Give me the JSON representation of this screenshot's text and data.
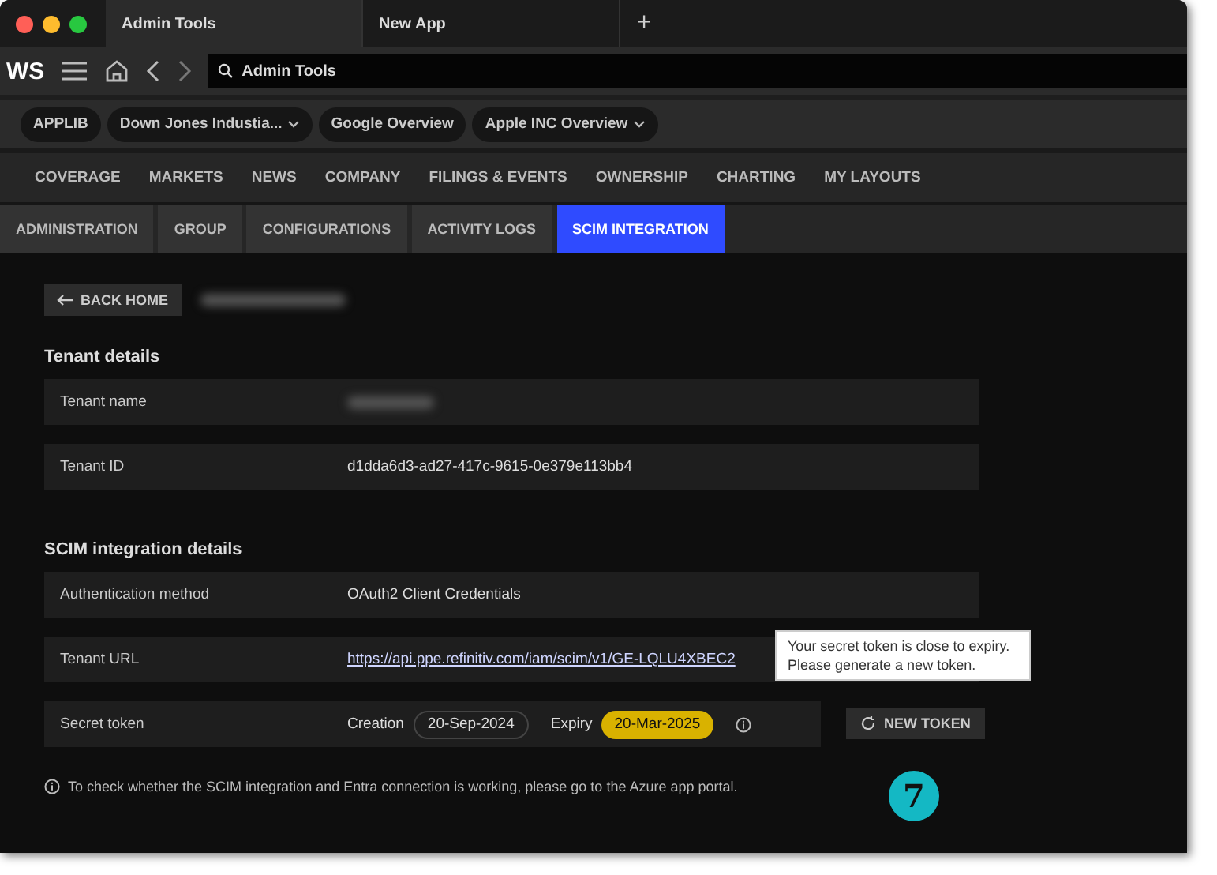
{
  "window_tabs": [
    {
      "label": "Admin Tools",
      "selected": true
    },
    {
      "label": "New App",
      "selected": false
    }
  ],
  "new_tab": "+",
  "toolbar": {
    "logo": "WS",
    "search_value": "Admin Tools"
  },
  "chips": [
    {
      "label": "APPLIB",
      "dropdown": false
    },
    {
      "label": "Down Jones Industia...",
      "dropdown": true
    },
    {
      "label": "Google Overview",
      "dropdown": false
    },
    {
      "label": "Apple INC Overview",
      "dropdown": true
    }
  ],
  "nav": [
    "COVERAGE",
    "MARKETS",
    "NEWS",
    "COMPANY",
    "FILINGS & EVENTS",
    "OWNERSHIP",
    "CHARTING",
    "MY LAYOUTS"
  ],
  "sub_tabs": [
    {
      "label": "ADMINISTRATION",
      "selected": false
    },
    {
      "label": "GROUP",
      "selected": false
    },
    {
      "label": "CONFIGURATIONS",
      "selected": false
    },
    {
      "label": "ACTIVITY LOGS",
      "selected": false
    },
    {
      "label": "SCIM INTEGRATION",
      "selected": true
    }
  ],
  "back_button": "BACK HOME",
  "sections": [
    {
      "title": "Tenant details",
      "rows": [
        {
          "kind": "text",
          "label": "Tenant name",
          "value": "",
          "redacted": true
        },
        {
          "kind": "text",
          "label": "Tenant ID",
          "value": "d1dda6d3-ad27-417c-9615-0e379e113bb4",
          "redacted": false
        }
      ]
    },
    {
      "title": "SCIM integration details",
      "rows": [
        {
          "kind": "text",
          "label": "Authentication method",
          "value": "OAuth2 Client Credentials",
          "redacted": false
        },
        {
          "kind": "link",
          "label": "Tenant URL",
          "value": "https://api.ppe.refinitiv.com/iam/scim/v1/GE-LQLU4XBEC2"
        },
        {
          "kind": "token",
          "label": "Secret token",
          "creation_label": "Creation",
          "creation": "20-Sep-2024",
          "expiry_label": "Expiry",
          "expiry": "20-Mar-2025",
          "expiring": true,
          "button": "NEW TOKEN"
        }
      ]
    }
  ],
  "tooltip": "Your secret token is close to expiry. Please generate a new token.",
  "footer_note": "To check whether the SCIM integration and Entra connection is working, please go to the Azure app portal.",
  "callout": "7"
}
